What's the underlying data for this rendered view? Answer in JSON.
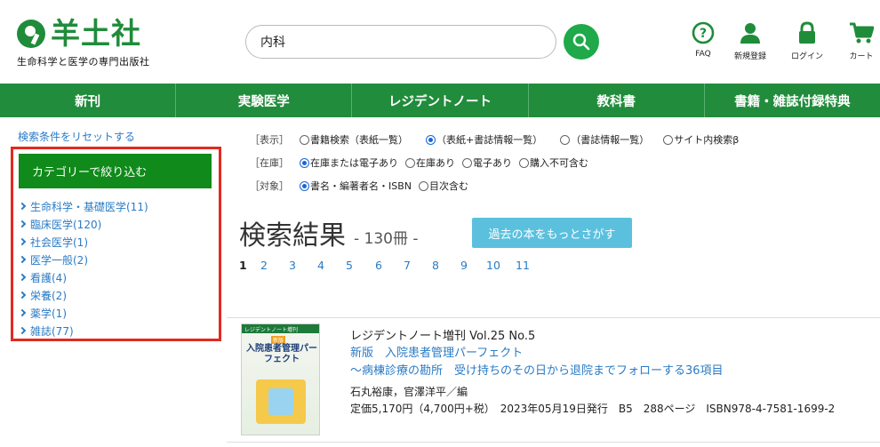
{
  "header": {
    "logo_text": "羊土社",
    "logo_sub": "生命科学と医学の専門出版社",
    "search": {
      "value": "内科",
      "placeholder": ""
    },
    "icons": [
      {
        "name": "faq-icon",
        "label": "FAQ"
      },
      {
        "name": "user-icon",
        "label": "新規登録"
      },
      {
        "name": "lock-icon",
        "label": "ログイン"
      },
      {
        "name": "cart-icon",
        "label": "カート"
      }
    ]
  },
  "nav": {
    "items": [
      "新刊",
      "実験医学",
      "レジデントノート",
      "教科書",
      "書籍・雑誌付録特典"
    ]
  },
  "sidebar": {
    "reset_link": "検索条件をリセットする",
    "category_button": "カテゴリーで絞り込む",
    "categories": [
      "生命科学・基礎医学(11)",
      "臨床医学(120)",
      "社会医学(1)",
      "医学一般(2)",
      "看護(4)",
      "栄養(2)",
      "薬学(1)",
      "雑誌(77)"
    ]
  },
  "filters": {
    "display": {
      "label": "［表示］",
      "options": [
        "書籍検索（表紙一覧）",
        "（表紙+書誌情報一覧）",
        "（書誌情報一覧）",
        "サイト内検索β"
      ],
      "selected": 1
    },
    "stock": {
      "label": "［在庫］",
      "options": [
        "在庫または電子あり",
        "在庫あり",
        "電子あり",
        "購入不可含む"
      ],
      "selected": 0
    },
    "target": {
      "label": "［対象］",
      "options": [
        "書名・編著者名・ISBN",
        "目次含む"
      ],
      "selected": 0
    }
  },
  "results": {
    "title": "検索結果",
    "count": "- 130冊 -",
    "past_button": "過去の本をもっとさがす",
    "pages": [
      "1",
      "2",
      "3",
      "4",
      "5",
      "6",
      "7",
      "8",
      "9",
      "10",
      "11"
    ],
    "current_page": "1"
  },
  "book": {
    "cover": {
      "band": "レジデントノート増刊",
      "badge": "新版",
      "title": "入院患者管理パーフェクト"
    },
    "series": "レジデントノート増刊 Vol.25 No.5",
    "title": "新版　入院患者管理パーフェクト",
    "subtitle": "～病棟診療の勘所　受け持ちのその日から退院までフォローする36項目",
    "authors": "石丸裕康，官澤洋平／編",
    "meta": "定価5,170円（4,700円+税）　2023年05月19日発行　B5　288ページ　ISBN978-4-7581-1699-2"
  },
  "colors": {
    "brand_green": "#218c3c",
    "link_blue": "#2a7bc5",
    "highlight_red": "#e12a20",
    "button_cyan": "#5bc0de"
  }
}
